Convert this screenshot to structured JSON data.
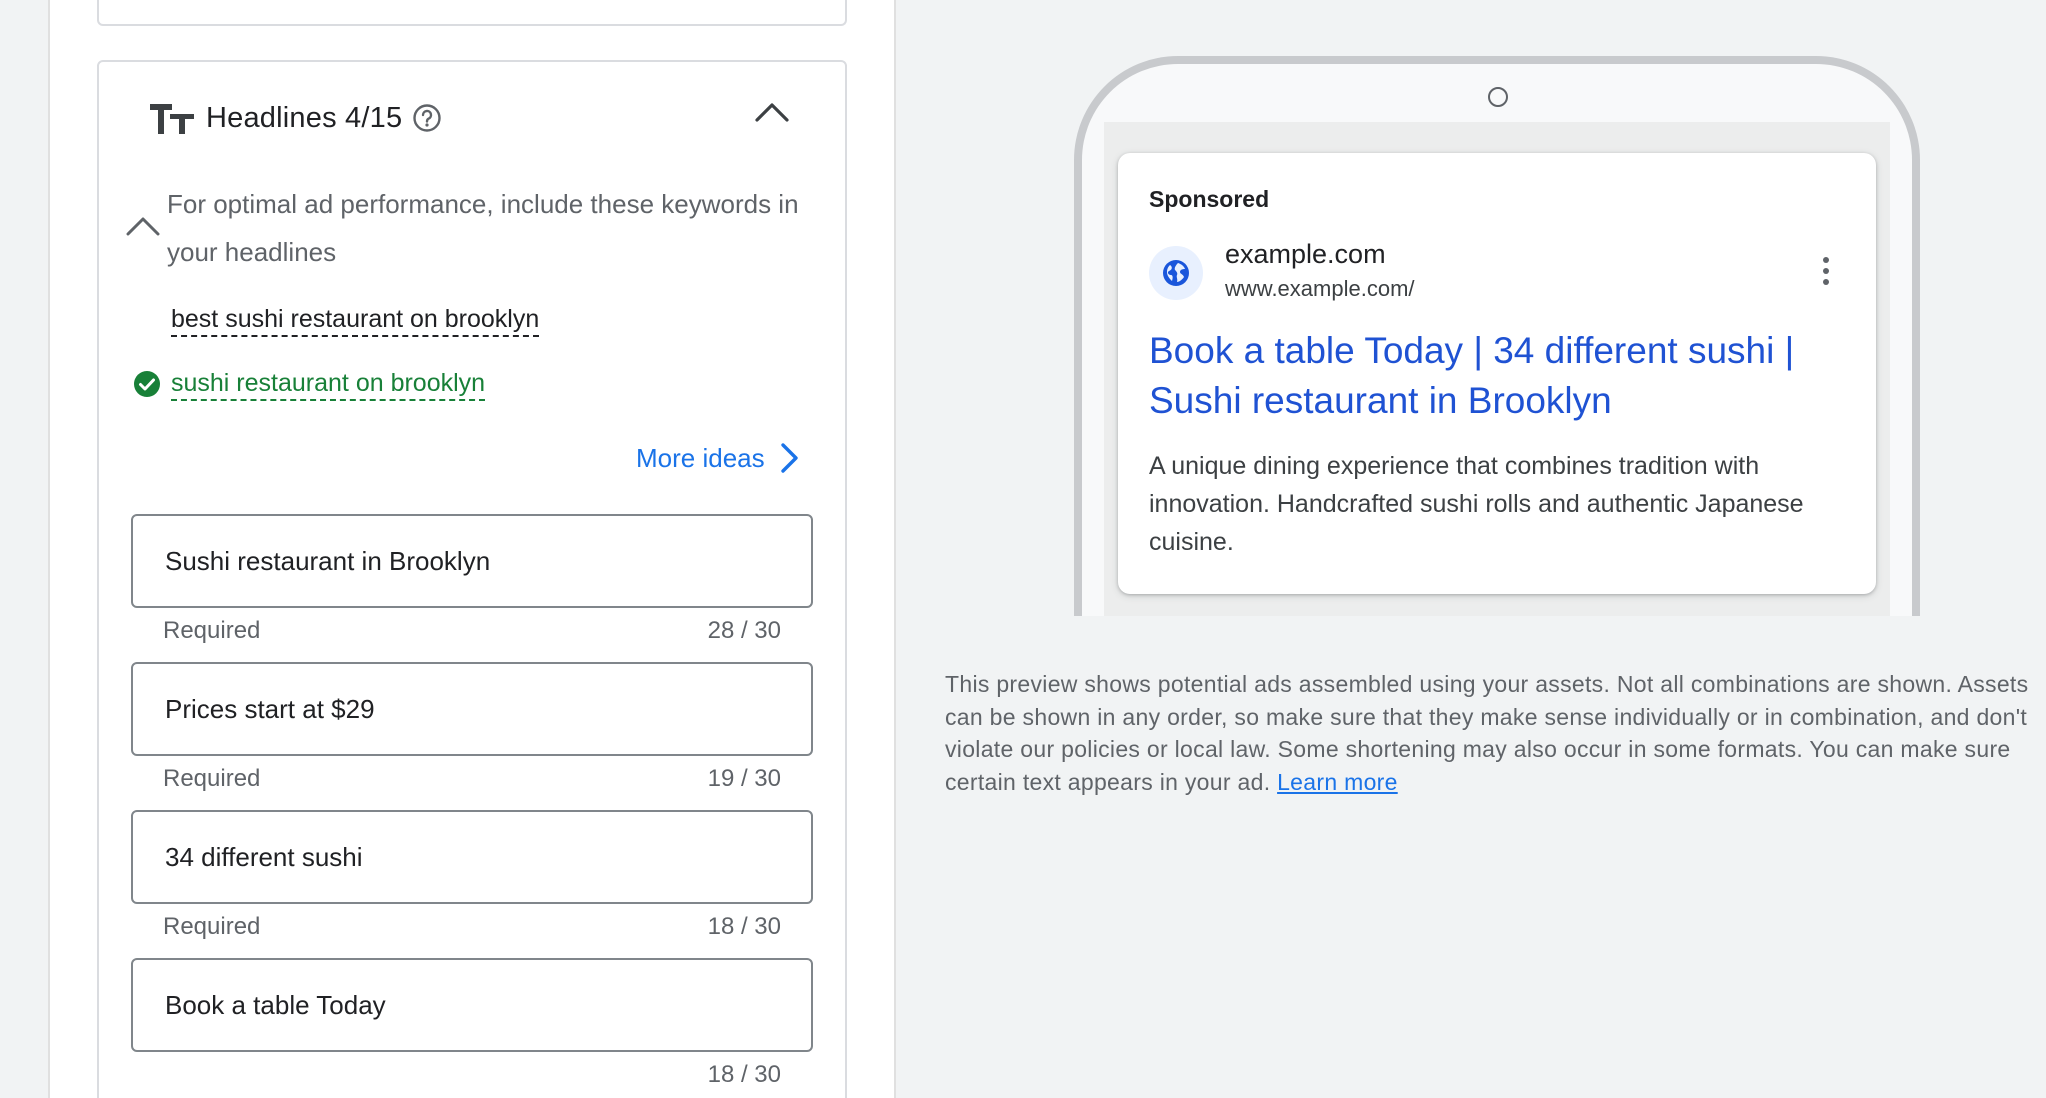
{
  "headlines": {
    "title": "Headlines 4/15",
    "icons": {
      "type": "text-format-icon",
      "help": "help-icon",
      "collapse": "chevron-up-icon"
    },
    "keyword_hint": "For optimal ad performance, include these keywords in your headlines",
    "keywords": [
      {
        "text": "best sushi restaurant on brooklyn",
        "included": false
      },
      {
        "text": "sushi restaurant on brooklyn",
        "included": true
      }
    ],
    "more_ideas_label": "More ideas",
    "fields": [
      {
        "value": "Sushi restaurant in Brooklyn",
        "status": "Required",
        "count": "28 / 30"
      },
      {
        "value": "Prices start at $29",
        "status": "Required",
        "count": "19 / 30"
      },
      {
        "value": "34 different sushi",
        "status": "Required",
        "count": "18 / 30"
      },
      {
        "value": "Book a table Today",
        "status": "",
        "count": "18 / 30"
      }
    ]
  },
  "preview": {
    "sponsored_label": "Sponsored",
    "site_name": "example.com",
    "display_url": "www.example.com/",
    "headline": "Book a table Today | 34 different sushi | Sushi restaurant in Brooklyn",
    "description": "A unique dining experience that combines tradition with innovation. Handcrafted sushi rolls and authentic Japanese cuisine.",
    "disclaimer": "This preview shows potential ads assembled using your assets. Not all combinations are shown. Assets can be shown in any order, so make sure that they make sense individually or in combination, and don't violate our policies or local law. Some shortening may also occur in some formats. You can make sure certain text appears in your ad.",
    "learn_more_label": "Learn more"
  },
  "colors": {
    "accent": "#1a73e8",
    "ad_headline": "#1f52d3",
    "success": "#188038",
    "background": "#f1f3f4"
  }
}
